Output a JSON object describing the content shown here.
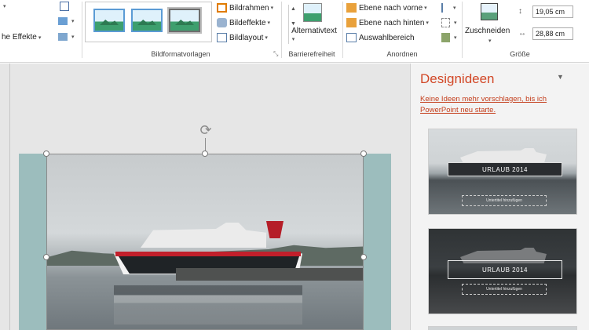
{
  "ribbon": {
    "effects_label": "he Effekte",
    "gallery_group_label": "Bildformatvorlagen",
    "frame_label": "Bildrahmen",
    "effects2_label": "Bildeffekte",
    "layout_label": "Bildlayout",
    "alt_text_label": "Alternativtext",
    "access_group_label": "Barrierefreiheit",
    "forward_label": "Ebene nach vorne",
    "backward_label": "Ebene nach hinten",
    "selection_label": "Auswahlbereich",
    "arrange_group_label": "Anordnen",
    "crop_label": "Zuschneiden",
    "height_value": "19,05 cm",
    "width_value": "28,88 cm",
    "size_group_label": "Größe"
  },
  "pane": {
    "title": "Designideen",
    "link": "Keine Ideen mehr vorschlagen, bis ich PowerPoint neu starte.",
    "card1_title": "URLAUB 2014",
    "card2_title": "URLAUB 2014",
    "card_subtitle": "Untertitel hinzufügen"
  },
  "colors": {
    "accent": "#d24726",
    "slide_bg": "#9cbdbd"
  }
}
